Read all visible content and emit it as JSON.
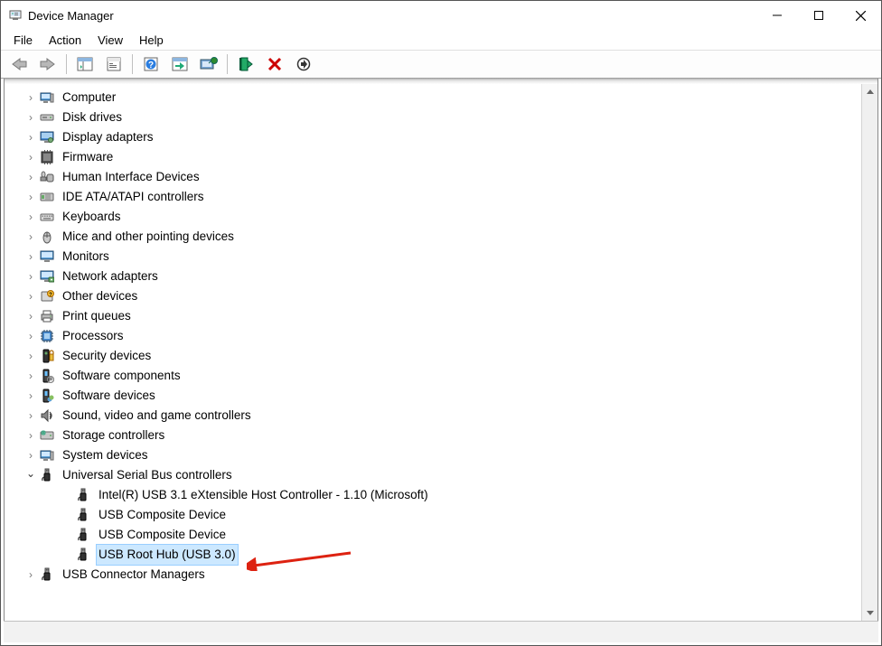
{
  "window": {
    "title": "Device Manager"
  },
  "menubar": {
    "file": "File",
    "action": "Action",
    "view": "View",
    "help": "Help"
  },
  "tree": {
    "items": [
      {
        "label": "Computer",
        "icon": "computer",
        "children": false
      },
      {
        "label": "Disk drives",
        "icon": "disk",
        "children": false
      },
      {
        "label": "Display adapters",
        "icon": "display",
        "children": false
      },
      {
        "label": "Firmware",
        "icon": "firmware",
        "children": false
      },
      {
        "label": "Human Interface Devices",
        "icon": "hid",
        "children": false
      },
      {
        "label": "IDE ATA/ATAPI controllers",
        "icon": "ide",
        "children": false
      },
      {
        "label": "Keyboards",
        "icon": "keyboard",
        "children": false
      },
      {
        "label": "Mice and other pointing devices",
        "icon": "mouse",
        "children": false
      },
      {
        "label": "Monitors",
        "icon": "monitor",
        "children": false
      },
      {
        "label": "Network adapters",
        "icon": "network",
        "children": false
      },
      {
        "label": "Other devices",
        "icon": "other",
        "children": false
      },
      {
        "label": "Print queues",
        "icon": "printer",
        "children": false
      },
      {
        "label": "Processors",
        "icon": "cpu",
        "children": false
      },
      {
        "label": "Security devices",
        "icon": "security",
        "children": false
      },
      {
        "label": "Software components",
        "icon": "swcomp",
        "children": false
      },
      {
        "label": "Software devices",
        "icon": "swdev",
        "children": false
      },
      {
        "label": "Sound, video and game controllers",
        "icon": "sound",
        "children": false
      },
      {
        "label": "Storage controllers",
        "icon": "storage",
        "children": false
      },
      {
        "label": "System devices",
        "icon": "system",
        "children": false
      },
      {
        "label": "Universal Serial Bus controllers",
        "icon": "usb",
        "expanded": true,
        "children": [
          {
            "label": "Intel(R) USB 3.1 eXtensible Host Controller - 1.10 (Microsoft)",
            "icon": "usb"
          },
          {
            "label": "USB Composite Device",
            "icon": "usb"
          },
          {
            "label": "USB Composite Device",
            "icon": "usb"
          },
          {
            "label": "USB Root Hub (USB 3.0)",
            "icon": "usb",
            "selected": true
          }
        ]
      },
      {
        "label": "USB Connector Managers",
        "icon": "usb",
        "children": false
      }
    ]
  }
}
